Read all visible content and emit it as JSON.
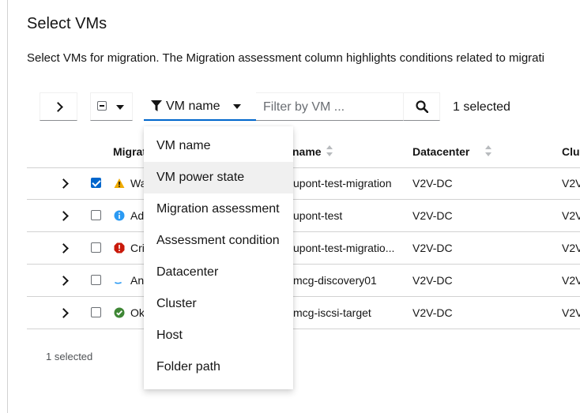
{
  "page": {
    "title": "Select VMs",
    "description": "Select VMs for migration. The Migration assessment column highlights conditions related to migrati"
  },
  "toolbar": {
    "filter_type_label": "VM name",
    "filter_placeholder": "Filter by VM ...",
    "selected_count": "1 selected"
  },
  "table": {
    "columns": {
      "migration_assessment": "Migrati",
      "vm_name": "name",
      "datacenter": "Datacenter",
      "cluster": "Clus"
    },
    "rows": [
      {
        "checked": true,
        "status": "warning",
        "assessment": "Wa",
        "vm_name": "upont-test-migration",
        "datacenter": "V2V-DC",
        "cluster": "V2V"
      },
      {
        "checked": false,
        "status": "info",
        "assessment": "Ad",
        "vm_name": "upont-test",
        "datacenter": "V2V-DC",
        "cluster": "V2V"
      },
      {
        "checked": false,
        "status": "critical",
        "assessment": "Cri",
        "vm_name": "upont-test-migratio...",
        "datacenter": "V2V-DC",
        "cluster": "V2V"
      },
      {
        "checked": false,
        "status": "loading",
        "assessment": "An",
        "vm_name": "mcg-discovery01",
        "datacenter": "V2V-DC",
        "cluster": "V2V"
      },
      {
        "checked": false,
        "status": "ok",
        "assessment": "Ok",
        "vm_name": "mcg-iscsi-target",
        "datacenter": "V2V-DC",
        "cluster": "V2V"
      }
    ]
  },
  "footer": {
    "selected_count": "1 selected"
  },
  "filter_menu": {
    "items": [
      "VM name",
      "VM power state",
      "Migration assessment",
      "Assessment condition",
      "Datacenter",
      "Cluster",
      "Host",
      "Folder path"
    ],
    "hovered": "VM power state"
  },
  "colors": {
    "accent": "#0066cc",
    "warning": "#f0ab00",
    "info": "#2b9af3",
    "critical": "#c9190b",
    "ok": "#3e8635"
  },
  "icons": {
    "expand": "chevron-right-icon",
    "filter": "filter-icon",
    "search": "search-icon",
    "dropdown": "caret-down-icon"
  }
}
